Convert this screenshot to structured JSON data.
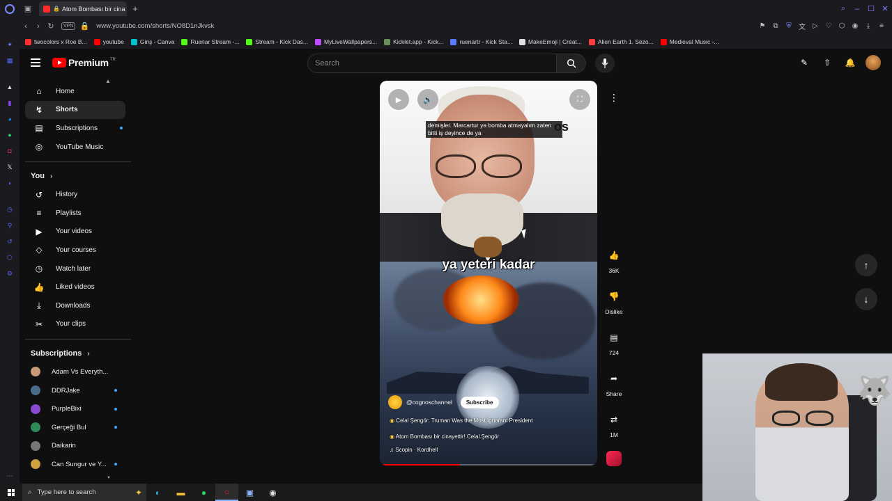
{
  "browser": {
    "tab_title": "Atom Bombası bir cina",
    "new_tab": "+",
    "url": "www.youtube.com/shorts/NO8D1nJkvsk",
    "vpn_label": "VPN",
    "bookmarks": [
      {
        "label": "twocolors x Roe B...",
        "color": "#ff3030"
      },
      {
        "label": "youtube",
        "color": "#ff0000"
      },
      {
        "label": "Giriş - Canva",
        "color": "#00c4cc"
      },
      {
        "label": "Ruenar Stream -...",
        "color": "#53fc18"
      },
      {
        "label": "Stream - Kick Das...",
        "color": "#53fc18"
      },
      {
        "label": "MyLiveWallpapers...",
        "color": "#c04cff"
      },
      {
        "label": "Kicklet.app - Kick...",
        "color": "#6a8f5a"
      },
      {
        "label": "ruenartr - Kick Sta...",
        "color": "#5b7cff"
      },
      {
        "label": "MakeEmoji | Creat...",
        "color": "#e0e0e0"
      },
      {
        "label": "Alien Earth 1. Sezo...",
        "color": "#ff3b3b"
      },
      {
        "label": "Medieval Music -...",
        "color": "#ff0000"
      }
    ]
  },
  "youtube": {
    "logo_text": "Premium",
    "logo_sup": "TR",
    "search_placeholder": "Search",
    "sidebar_main": [
      {
        "label": "Home",
        "icon": "⌂"
      },
      {
        "label": "Shorts",
        "icon": "↯"
      },
      {
        "label": "Subscriptions",
        "icon": "▤"
      },
      {
        "label": "YouTube Music",
        "icon": "◎"
      }
    ],
    "you_heading": "You",
    "sidebar_you": [
      {
        "label": "History",
        "icon": "↺"
      },
      {
        "label": "Playlists",
        "icon": "≡"
      },
      {
        "label": "Your videos",
        "icon": "▶"
      },
      {
        "label": "Your courses",
        "icon": "◇"
      },
      {
        "label": "Watch later",
        "icon": "◷"
      },
      {
        "label": "Liked videos",
        "icon": "👍"
      },
      {
        "label": "Downloads",
        "icon": "⤓"
      },
      {
        "label": "Your clips",
        "icon": "✂"
      }
    ],
    "subscriptions_heading": "Subscriptions",
    "subscriptions": [
      {
        "name": "Adam Vs Everyth...",
        "color": "#c89a7a",
        "dot": false
      },
      {
        "name": "DDRJake",
        "color": "#4a6a8a",
        "dot": true
      },
      {
        "name": "PurpleBixi",
        "color": "#8a4ad0",
        "dot": true
      },
      {
        "name": "Gerçeği Bul",
        "color": "#2e8b57",
        "dot": true
      },
      {
        "name": "Daikarin",
        "color": "#777777",
        "dot": false
      },
      {
        "name": "Can Sungur ve Y...",
        "color": "#d0a040",
        "dot": true
      }
    ]
  },
  "short": {
    "caption_overlay": "demişler. Marcartur ya bomba atmayalım zaten bitti iş deyince de ya",
    "caption_bg_text": "os",
    "big_caption": "ya yeteri kadar",
    "channel": "@cognoschannel",
    "subscribe": "Subscribe",
    "title_line1": "Celal Şengör: Truman Was the Most Ignorant President",
    "title_line2": "Atom Bombası bir cinayettir! Celal Şengör",
    "music": "Scopin · Kordhell",
    "progress": 0.37
  },
  "actions": {
    "likes": "36K",
    "dislike": "Dislike",
    "comments": "724",
    "share": "Share",
    "remix": "1M"
  },
  "taskbar": {
    "search_placeholder": "Type here to search"
  },
  "colors": {
    "accent": "#ff0000",
    "background": "#0f0f0f",
    "sidebar_active": "#272727"
  }
}
